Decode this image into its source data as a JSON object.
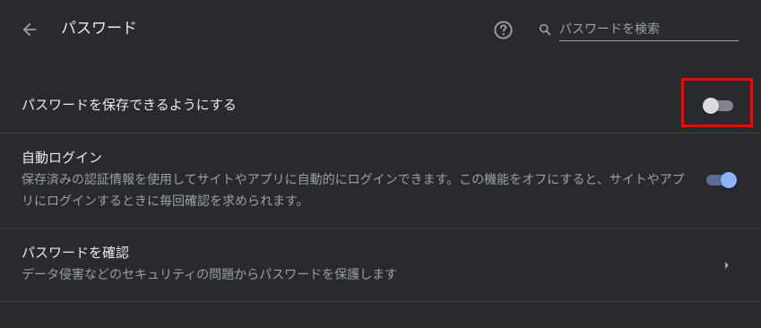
{
  "header": {
    "title": "パスワード",
    "back_icon": "arrow-left-icon",
    "help_icon": "help-circle-icon",
    "search_icon": "search-icon",
    "search_placeholder": "パスワードを検索"
  },
  "settings": {
    "offer_to_save": {
      "label": "パスワードを保存できるようにする",
      "enabled": false
    },
    "auto_signin": {
      "label": "自動ログイン",
      "description": "保存済みの認証情報を使用してサイトやアプリに自動的にログインできます。この機能をオフにすると、サイトやアプリにログインするときに毎回確認を求められます。",
      "enabled": true
    },
    "check_passwords": {
      "label": "パスワードを確認",
      "description": "データ侵害などのセキュリティの問題からパスワードを保護します",
      "chevron_icon": "chevron-right-icon"
    }
  },
  "colors": {
    "background": "#292a2d",
    "text_primary": "#e8eaed",
    "text_secondary": "#9aa0a6",
    "toggle_on_knob": "#8ab4f8",
    "toggle_on_track": "#5a6d99",
    "toggle_off_knob": "#dadce0",
    "toggle_off_track": "#80868b",
    "highlight": "#ff0000",
    "divider": "#3f4042"
  }
}
